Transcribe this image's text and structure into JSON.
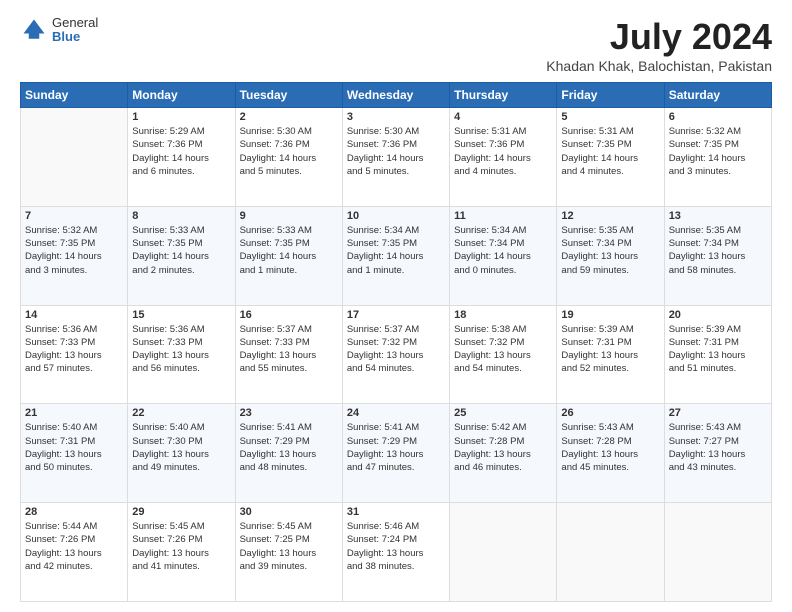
{
  "logo": {
    "general": "General",
    "blue": "Blue"
  },
  "title": "July 2024",
  "subtitle": "Khadan Khak, Balochistan, Pakistan",
  "weekdays": [
    "Sunday",
    "Monday",
    "Tuesday",
    "Wednesday",
    "Thursday",
    "Friday",
    "Saturday"
  ],
  "weeks": [
    [
      {
        "day": "",
        "info": ""
      },
      {
        "day": "1",
        "info": "Sunrise: 5:29 AM\nSunset: 7:36 PM\nDaylight: 14 hours\nand 6 minutes."
      },
      {
        "day": "2",
        "info": "Sunrise: 5:30 AM\nSunset: 7:36 PM\nDaylight: 14 hours\nand 5 minutes."
      },
      {
        "day": "3",
        "info": "Sunrise: 5:30 AM\nSunset: 7:36 PM\nDaylight: 14 hours\nand 5 minutes."
      },
      {
        "day": "4",
        "info": "Sunrise: 5:31 AM\nSunset: 7:36 PM\nDaylight: 14 hours\nand 4 minutes."
      },
      {
        "day": "5",
        "info": "Sunrise: 5:31 AM\nSunset: 7:35 PM\nDaylight: 14 hours\nand 4 minutes."
      },
      {
        "day": "6",
        "info": "Sunrise: 5:32 AM\nSunset: 7:35 PM\nDaylight: 14 hours\nand 3 minutes."
      }
    ],
    [
      {
        "day": "7",
        "info": "Sunrise: 5:32 AM\nSunset: 7:35 PM\nDaylight: 14 hours\nand 3 minutes."
      },
      {
        "day": "8",
        "info": "Sunrise: 5:33 AM\nSunset: 7:35 PM\nDaylight: 14 hours\nand 2 minutes."
      },
      {
        "day": "9",
        "info": "Sunrise: 5:33 AM\nSunset: 7:35 PM\nDaylight: 14 hours\nand 1 minute."
      },
      {
        "day": "10",
        "info": "Sunrise: 5:34 AM\nSunset: 7:35 PM\nDaylight: 14 hours\nand 1 minute."
      },
      {
        "day": "11",
        "info": "Sunrise: 5:34 AM\nSunset: 7:34 PM\nDaylight: 14 hours\nand 0 minutes."
      },
      {
        "day": "12",
        "info": "Sunrise: 5:35 AM\nSunset: 7:34 PM\nDaylight: 13 hours\nand 59 minutes."
      },
      {
        "day": "13",
        "info": "Sunrise: 5:35 AM\nSunset: 7:34 PM\nDaylight: 13 hours\nand 58 minutes."
      }
    ],
    [
      {
        "day": "14",
        "info": "Sunrise: 5:36 AM\nSunset: 7:33 PM\nDaylight: 13 hours\nand 57 minutes."
      },
      {
        "day": "15",
        "info": "Sunrise: 5:36 AM\nSunset: 7:33 PM\nDaylight: 13 hours\nand 56 minutes."
      },
      {
        "day": "16",
        "info": "Sunrise: 5:37 AM\nSunset: 7:33 PM\nDaylight: 13 hours\nand 55 minutes."
      },
      {
        "day": "17",
        "info": "Sunrise: 5:37 AM\nSunset: 7:32 PM\nDaylight: 13 hours\nand 54 minutes."
      },
      {
        "day": "18",
        "info": "Sunrise: 5:38 AM\nSunset: 7:32 PM\nDaylight: 13 hours\nand 54 minutes."
      },
      {
        "day": "19",
        "info": "Sunrise: 5:39 AM\nSunset: 7:31 PM\nDaylight: 13 hours\nand 52 minutes."
      },
      {
        "day": "20",
        "info": "Sunrise: 5:39 AM\nSunset: 7:31 PM\nDaylight: 13 hours\nand 51 minutes."
      }
    ],
    [
      {
        "day": "21",
        "info": "Sunrise: 5:40 AM\nSunset: 7:31 PM\nDaylight: 13 hours\nand 50 minutes."
      },
      {
        "day": "22",
        "info": "Sunrise: 5:40 AM\nSunset: 7:30 PM\nDaylight: 13 hours\nand 49 minutes."
      },
      {
        "day": "23",
        "info": "Sunrise: 5:41 AM\nSunset: 7:29 PM\nDaylight: 13 hours\nand 48 minutes."
      },
      {
        "day": "24",
        "info": "Sunrise: 5:41 AM\nSunset: 7:29 PM\nDaylight: 13 hours\nand 47 minutes."
      },
      {
        "day": "25",
        "info": "Sunrise: 5:42 AM\nSunset: 7:28 PM\nDaylight: 13 hours\nand 46 minutes."
      },
      {
        "day": "26",
        "info": "Sunrise: 5:43 AM\nSunset: 7:28 PM\nDaylight: 13 hours\nand 45 minutes."
      },
      {
        "day": "27",
        "info": "Sunrise: 5:43 AM\nSunset: 7:27 PM\nDaylight: 13 hours\nand 43 minutes."
      }
    ],
    [
      {
        "day": "28",
        "info": "Sunrise: 5:44 AM\nSunset: 7:26 PM\nDaylight: 13 hours\nand 42 minutes."
      },
      {
        "day": "29",
        "info": "Sunrise: 5:45 AM\nSunset: 7:26 PM\nDaylight: 13 hours\nand 41 minutes."
      },
      {
        "day": "30",
        "info": "Sunrise: 5:45 AM\nSunset: 7:25 PM\nDaylight: 13 hours\nand 39 minutes."
      },
      {
        "day": "31",
        "info": "Sunrise: 5:46 AM\nSunset: 7:24 PM\nDaylight: 13 hours\nand 38 minutes."
      },
      {
        "day": "",
        "info": ""
      },
      {
        "day": "",
        "info": ""
      },
      {
        "day": "",
        "info": ""
      }
    ]
  ]
}
